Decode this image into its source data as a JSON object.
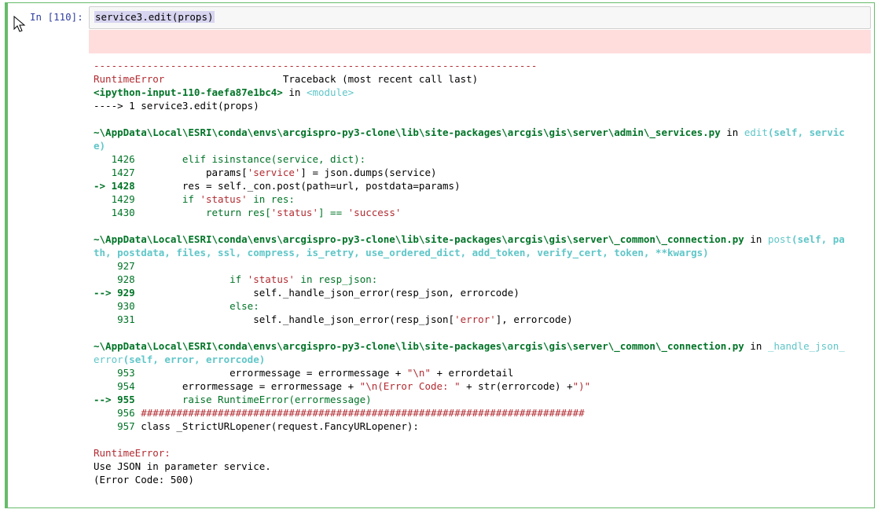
{
  "cell": {
    "prompt": "In [110]:",
    "input_code": "service3.edit(props)"
  },
  "traceback": {
    "separator": "---------------------------------------------------------------------------",
    "error_name": "RuntimeError",
    "header_right": "Traceback (most recent call last)",
    "input_ref": "<ipython-input-110-faefa87e1bc4>",
    "in_word": " in ",
    "module": "<module>",
    "first_arrow_line": "----> 1 service3.edit(props)",
    "frames": [
      {
        "path": "~\\AppData\\Local\\ESRI\\conda\\envs\\arcgispro-py3-clone\\lib\\site-packages\\arcgis\\gis\\server\\admin\\_services.py",
        "func": "edit",
        "args_line1": "(self, servic",
        "args_line2": "e)",
        "lines": [
          {
            "prefix": "   1426",
            "code_a": "        elif isinstance(service, dict):"
          },
          {
            "prefix": "   1427",
            "code_a": "            params[",
            "str1": "'service'",
            "code_b": "] = json.dumps(service)"
          },
          {
            "prefix": "-> 1428",
            "code_a": "        res = self._con.post(path=url, postdata=params)"
          },
          {
            "prefix": "   1429",
            "code_a": "        if ",
            "str1": "'status'",
            "code_b": " in res:"
          },
          {
            "prefix": "   1430",
            "code_a": "            return res[",
            "str1": "'status'",
            "code_b": "] == ",
            "str2": "'success'"
          }
        ]
      },
      {
        "path": "~\\AppData\\Local\\ESRI\\conda\\envs\\arcgispro-py3-clone\\lib\\site-packages\\arcgis\\gis\\server\\_common\\_connection.py",
        "func": "post",
        "args_line1": "(self, pa",
        "args_line2": "th, postdata, files, ssl, compress, is_retry, use_ordered_dict, add_token, verify_cert, token, **kwargs)",
        "lines": [
          {
            "prefix": "    927",
            "code_a": ""
          },
          {
            "prefix": "    928",
            "code_a": "                if ",
            "str1": "'status'",
            "code_b": " in resp_json:"
          },
          {
            "prefix": "--> 929",
            "code_a": "                    self._handle_json_error(resp_json, errorcode)"
          },
          {
            "prefix": "    930",
            "code_a": "                else:"
          },
          {
            "prefix": "    931",
            "code_a": "                    self._handle_json_error(resp_json[",
            "str1": "'error'",
            "code_b": "], errorcode)"
          }
        ]
      },
      {
        "path": "~\\AppData\\Local\\ESRI\\conda\\envs\\arcgispro-py3-clone\\lib\\site-packages\\arcgis\\gis\\server\\_common\\_connection.py",
        "func_part1": "_handle_json_",
        "func_part2": "error",
        "args_line2": "(self, error, errorcode)",
        "lines": [
          {
            "prefix": "    953",
            "code_a": "                errormessage = errormessage + ",
            "str1": "\"\\n\"",
            "code_b": " + errordetail"
          },
          {
            "prefix": "    954",
            "code_a": "        errormessage = errormessage + ",
            "str1": "\"\\n(Error Code: \"",
            "code_b": " + str(errorcode) +",
            "str2": "\")\""
          },
          {
            "prefix": "--> 955",
            "code_a": "        raise RuntimeError(errormessage)"
          },
          {
            "prefix": "    956",
            "comment": " ###########################################################################"
          },
          {
            "prefix": "    957",
            "code_a": " class _StrictURLopener(request.FancyURLopener):"
          }
        ]
      }
    ],
    "final_error": "RuntimeError:",
    "final_message_1": "Use JSON in parameter service.",
    "final_message_2": "(Error Code: 500)"
  },
  "colors": {
    "cell_border": "#66bb6a",
    "prompt": "#303f9f",
    "error_red": "#b22b31",
    "path_green": "#007427",
    "func_cyan": "#60c6c8",
    "error_bg": "#ffdddd"
  }
}
